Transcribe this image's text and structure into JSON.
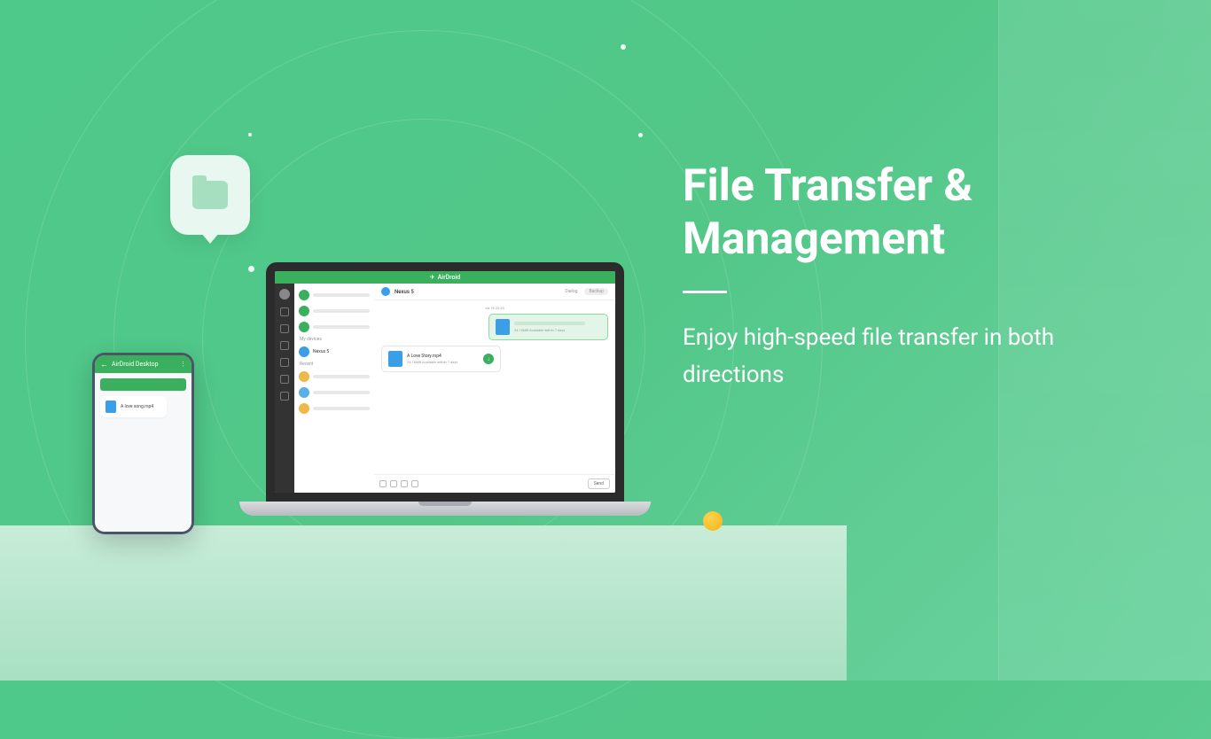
{
  "hero": {
    "title": "File Transfer & Management",
    "subtitle": "Enjoy high-speed file transfer in both directions"
  },
  "app": {
    "brand": "AirDroid",
    "phone_title": "AirDroid Desktop",
    "phone_file": "A love song.mp4",
    "contacts": {
      "section_my": "My devices",
      "section_recent": "Recent",
      "nexus": "Nexus 5"
    },
    "chat": {
      "name": "Nexus 5",
      "tab_dialog": "Dialog",
      "tab_backup": "Backup",
      "date": "via 16 22:23",
      "file_name": "A Love Story.mp4",
      "file_meta": "24.16MB   Available within 7 days",
      "sent_meta": "24.16MB   Available within 7 days",
      "send_label": "Send"
    }
  },
  "colors": {
    "accent": "#3aaf5e",
    "blue": "#3b9fe8"
  }
}
